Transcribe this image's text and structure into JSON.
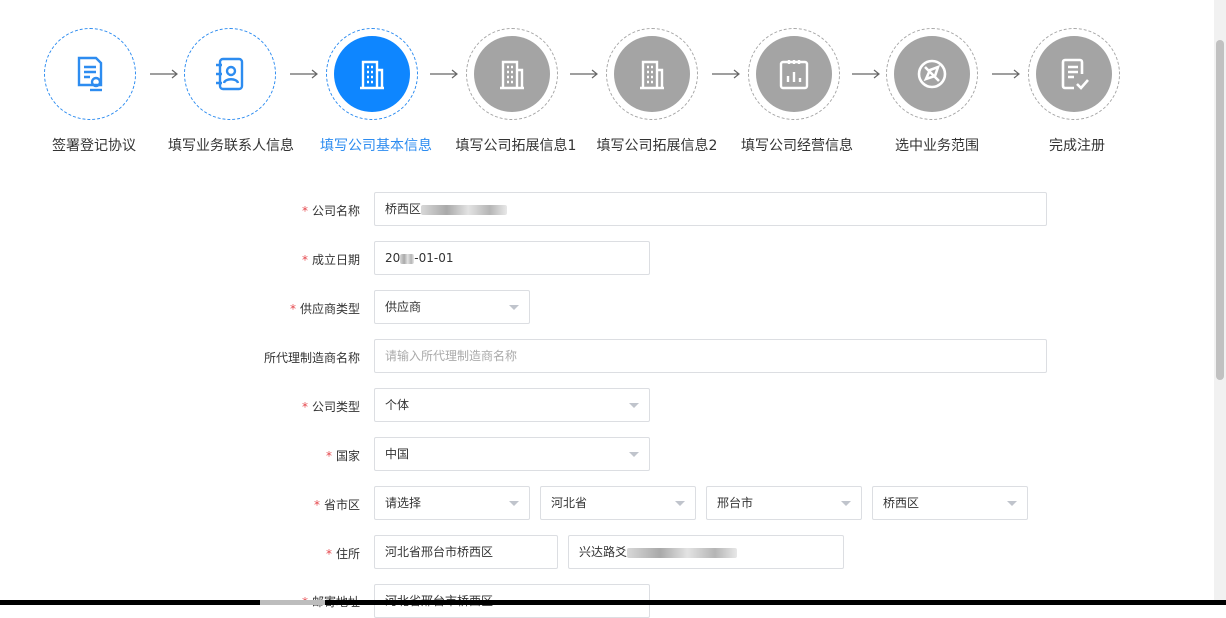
{
  "steps": [
    {
      "label": "签署登记协议",
      "state": "done",
      "icon": "contract-icon"
    },
    {
      "label": "填写业务联系人信息",
      "state": "done",
      "icon": "contact-book-icon"
    },
    {
      "label": "填写公司基本信息",
      "state": "active",
      "icon": "building-icon"
    },
    {
      "label": "填写公司拓展信息1",
      "state": "todo",
      "icon": "building-icon"
    },
    {
      "label": "填写公司拓展信息2",
      "state": "todo",
      "icon": "building-icon"
    },
    {
      "label": "填写公司经营信息",
      "state": "todo",
      "icon": "chart-icon"
    },
    {
      "label": "选中业务范围",
      "state": "todo",
      "icon": "compass-icon"
    },
    {
      "label": "完成注册",
      "state": "todo",
      "icon": "checklist-icon"
    }
  ],
  "form": {
    "company_name": {
      "label": "公司名称",
      "required": true,
      "value": "桥西区"
    },
    "found_date": {
      "label": "成立日期",
      "required": true,
      "value_prefix": "20",
      "value_suffix": "-01-01"
    },
    "supplier_type": {
      "label": "供应商类型",
      "required": true,
      "value": "供应商"
    },
    "agent_manufacturer": {
      "label": "所代理制造商名称",
      "required": false,
      "placeholder": "请输入所代理制造商名称"
    },
    "company_type": {
      "label": "公司类型",
      "required": true,
      "value": "个体"
    },
    "country": {
      "label": "国家",
      "required": true,
      "value": "中国"
    },
    "region": {
      "label": "省市区",
      "required": true,
      "values": [
        "请选择",
        "河北省",
        "邢台市",
        "桥西区"
      ]
    },
    "address": {
      "label": "住所",
      "required": true,
      "value1": "河北省邢台市桥西区",
      "value2": "兴达路爻"
    },
    "mail_address": {
      "label": "邮寄地址",
      "required": true,
      "value": "河北省邢台市桥西区"
    }
  },
  "colors": {
    "primary": "#0e86ff",
    "inactive": "#a4a4a4",
    "required": "#e5484d"
  }
}
